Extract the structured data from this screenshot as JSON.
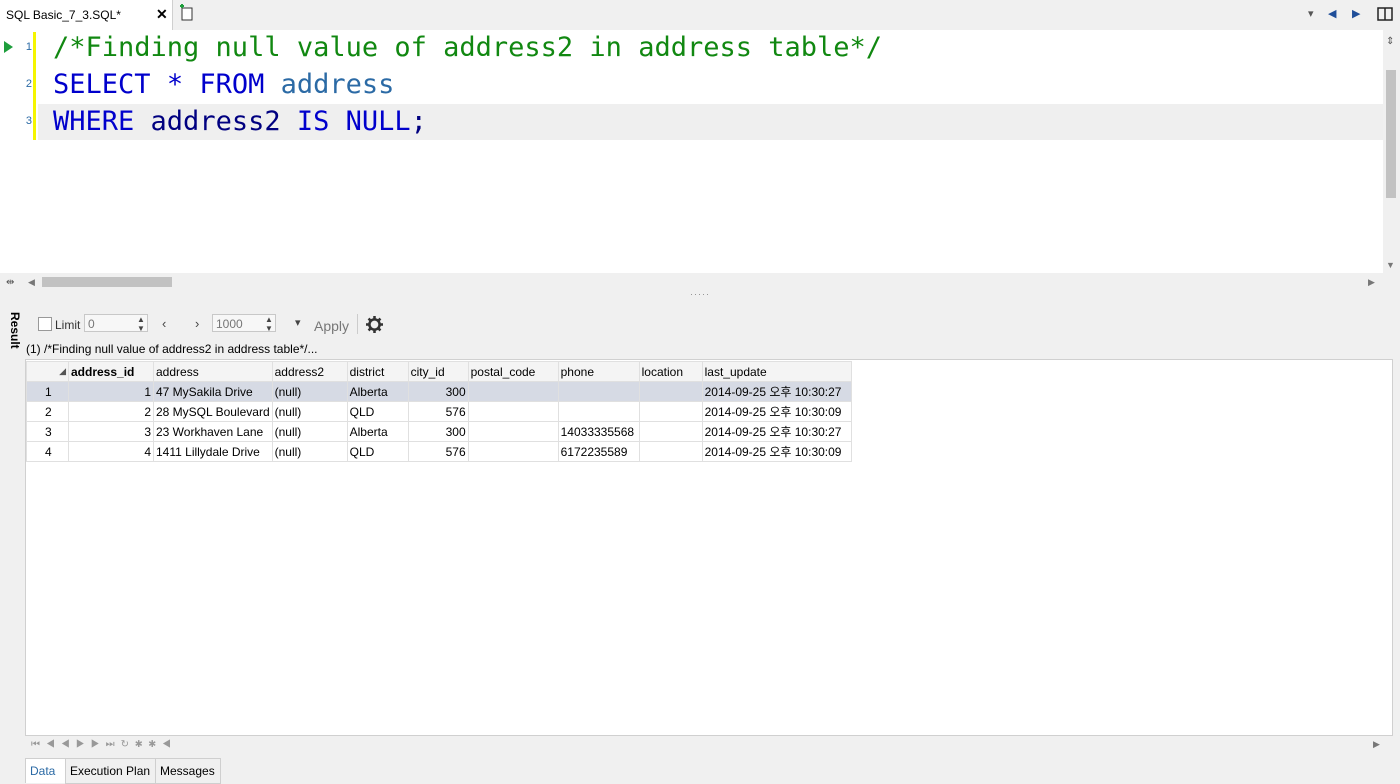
{
  "tab": {
    "title": "SQL Basic_7_3.SQL*",
    "close": "✕"
  },
  "editor": {
    "line_numbers": [
      "1",
      "2",
      "3"
    ],
    "line1": "/*Finding null value of address2 in address table*/",
    "line2_kw1": "SELECT",
    "line2_star": "*",
    "line2_kw2": "FROM",
    "line2_table": "address",
    "line3_kw1": "WHERE",
    "line3_col": "address2",
    "line3_kw2": "IS",
    "line3_kw3": "NULL",
    "line3_semi": ";"
  },
  "result": {
    "side_label": "Result",
    "limit_label": "Limit",
    "limit_value": "0",
    "page_size": "1000",
    "apply_label": "Apply",
    "query_label": "(1) /*Finding null value of address2 in address table*/...",
    "columns": [
      "address_id",
      "address",
      "address2",
      "district",
      "city_id",
      "postal_code",
      "phone",
      "location",
      "last_update"
    ],
    "rows": [
      {
        "n": "1",
        "address_id": "1",
        "address": "47 MySakila Drive",
        "address2": "(null)",
        "district": "Alberta",
        "city_id": "300",
        "postal_code": "",
        "phone": "",
        "location": "",
        "last_update": "2014-09-25 오후 10:30:27"
      },
      {
        "n": "2",
        "address_id": "2",
        "address": "28 MySQL Boulevard",
        "address2": "(null)",
        "district": "QLD",
        "city_id": "576",
        "postal_code": "",
        "phone": "",
        "location": "",
        "last_update": "2014-09-25 오후 10:30:09"
      },
      {
        "n": "3",
        "address_id": "3",
        "address": "23 Workhaven Lane",
        "address2": "(null)",
        "district": "Alberta",
        "city_id": "300",
        "postal_code": "",
        "phone": "14033335568",
        "location": "",
        "last_update": "2014-09-25 오후 10:30:27"
      },
      {
        "n": "4",
        "address_id": "4",
        "address": "1411 Lillydale Drive",
        "address2": "(null)",
        "district": "QLD",
        "city_id": "576",
        "postal_code": "",
        "phone": "6172235589",
        "location": "",
        "last_update": "2014-09-25 오후 10:30:09"
      }
    ],
    "bottom_tabs": [
      "Data",
      "Execution Plan",
      "Messages"
    ]
  },
  "icons": [
    "run-arrow-icon",
    "gear-icon",
    "new-tab-icon",
    "nav-back-icon",
    "nav-forward-icon",
    "layout-icon"
  ]
}
